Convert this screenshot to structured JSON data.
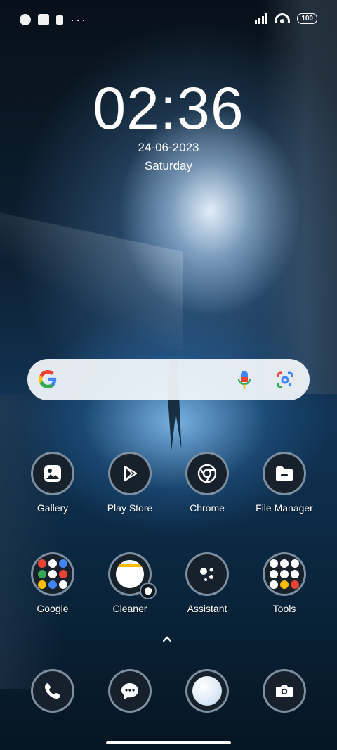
{
  "status_bar": {
    "battery": "100",
    "icons": [
      "app-notification-icon",
      "square-notification-icon",
      "sim-notification-icon",
      "more-notifications-icon",
      "signal-icon",
      "wifi-icon",
      "battery-icon"
    ]
  },
  "lockclock": {
    "time": "02:36",
    "date": "24-06-2023",
    "day": "Saturday"
  },
  "search_bar": {
    "icons": [
      "google-logo-icon",
      "microphone-icon",
      "google-lens-icon"
    ]
  },
  "apps": [
    {
      "label": "Gallery",
      "icon": "gallery-icon"
    },
    {
      "label": "Play Store",
      "icon": "play-store-icon"
    },
    {
      "label": "Chrome",
      "icon": "chrome-icon"
    },
    {
      "label": "File Manager",
      "icon": "folder-icon"
    },
    {
      "label": "Google",
      "icon": "google-folder-icon"
    },
    {
      "label": "Cleaner",
      "icon": "cleaner-icon"
    },
    {
      "label": "Assistant",
      "icon": "assistant-icon"
    },
    {
      "label": "Tools",
      "icon": "tools-folder-icon"
    }
  ],
  "dock": [
    {
      "icon": "phone-icon"
    },
    {
      "icon": "messages-icon"
    },
    {
      "icon": "browser-icon"
    },
    {
      "icon": "camera-icon"
    }
  ],
  "colors": {
    "accent_blue": "#4285F4",
    "accent_red": "#EA4335",
    "accent_yellow": "#FBBC05",
    "accent_green": "#34A853",
    "icon_background": "#17212b"
  }
}
